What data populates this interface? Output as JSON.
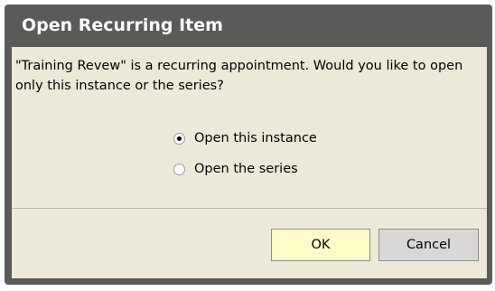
{
  "dialog": {
    "title": "Open Recurring Item",
    "message": "\"Training Revew\" is a recurring appointment. Would you like to open only this instance or the series?",
    "options": [
      {
        "label": "Open this instance",
        "checked": true
      },
      {
        "label": "Open the series",
        "checked": false
      }
    ],
    "buttons": {
      "ok_label": "OK",
      "cancel_label": "Cancel"
    }
  },
  "colors": {
    "title_bar": "#5a5a58",
    "panel": "#ece9d8",
    "ok_button": "#fdfbc8",
    "cancel_button": "#d9d8d6"
  }
}
